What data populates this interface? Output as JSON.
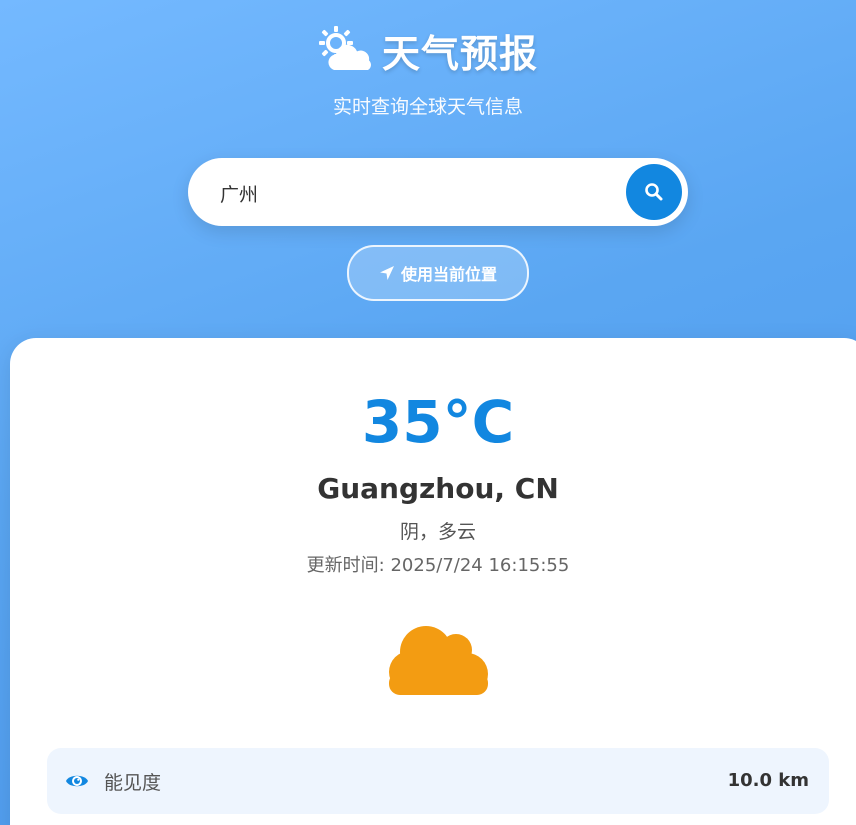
{
  "header": {
    "title": "天气预报",
    "title_icon": "sun-behind-cloud-icon",
    "subtitle": "实时查询全球天气信息"
  },
  "search": {
    "value": "广州",
    "button_icon": "search-icon"
  },
  "location_button": {
    "label": "使用当前位置",
    "icon": "location-arrow-icon"
  },
  "weather": {
    "temperature": "35°C",
    "city": "Guangzhou, CN",
    "description": "阴，多云",
    "updated": "更新时间: 2025/7/24 16:15:55",
    "icon": "cloud-icon",
    "icon_color": "#f39c12"
  },
  "details": [
    {
      "icon": "eye-icon",
      "label": "能见度",
      "value": "10.0 km"
    }
  ],
  "colors": {
    "accent": "#1287e0",
    "background_gradient_start": "#74b9ff",
    "background_gradient_end": "#4a97ec"
  }
}
